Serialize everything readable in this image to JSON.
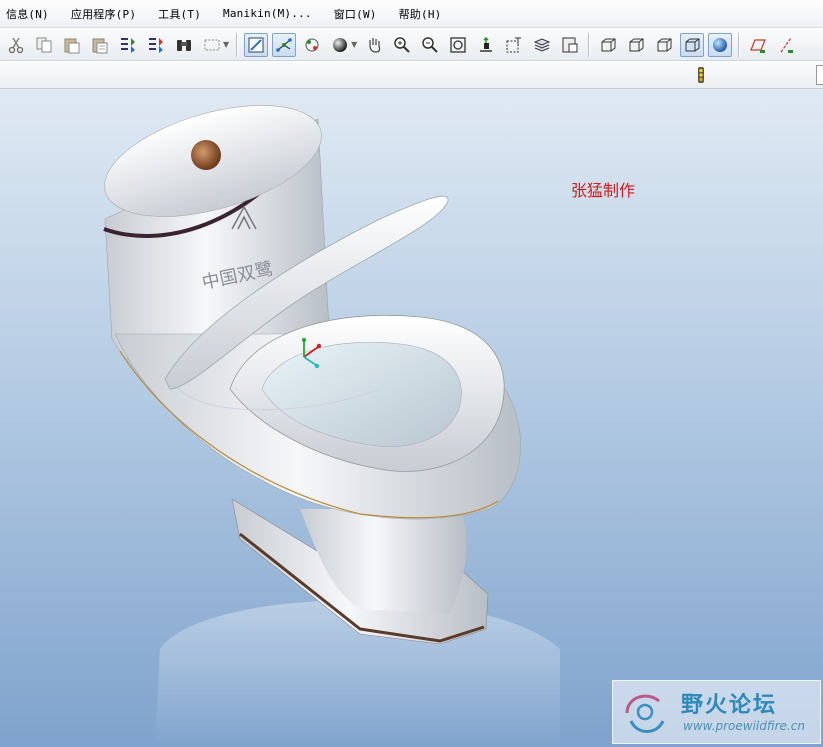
{
  "menu": {
    "items": [
      {
        "label": "信息(N)"
      },
      {
        "label": "应用程序(P)"
      },
      {
        "label": "工具(T)"
      },
      {
        "label": "Manikin(M)..."
      },
      {
        "label": "窗口(W)"
      },
      {
        "label": "帮助(H)"
      }
    ]
  },
  "toolbar": {
    "buttons": [
      {
        "icon": "cut-icon"
      },
      {
        "icon": "copy-icon"
      },
      {
        "icon": "paste-icon"
      },
      {
        "icon": "paste-special-icon"
      },
      {
        "icon": "regenerate-icon"
      },
      {
        "icon": "regenerate-manager-icon"
      },
      {
        "icon": "find-icon"
      },
      {
        "icon": "select-box-icon"
      },
      {
        "icon": "redraw-icon"
      },
      {
        "icon": "spin-center-icon"
      },
      {
        "icon": "orient-mode-icon"
      },
      {
        "icon": "appearance-gallery-icon"
      },
      {
        "icon": "pan-icon"
      },
      {
        "icon": "zoom-in-icon"
      },
      {
        "icon": "zoom-out-icon"
      },
      {
        "icon": "refit-icon"
      },
      {
        "icon": "reorient-icon"
      },
      {
        "icon": "saved-views-icon"
      },
      {
        "icon": "layers-icon"
      },
      {
        "icon": "view-manager-icon"
      },
      {
        "icon": "wireframe-icon"
      },
      {
        "icon": "hidden-line-icon"
      },
      {
        "icon": "no-hidden-icon"
      },
      {
        "icon": "shading-icon"
      },
      {
        "icon": "enhanced-realism-icon"
      },
      {
        "icon": "datum-plane-icon"
      },
      {
        "icon": "datum-axis-icon"
      }
    ]
  },
  "status": {
    "icon": "traffic-light-icon"
  },
  "viewport": {
    "credit_text": "张猛制作",
    "model_logo_text": "中国双鹭"
  },
  "watermark": {
    "title": "野火论坛",
    "url": "www.proewildfire.cn"
  },
  "colors": {
    "credit": "#d01c1c",
    "watermark": "#2e89b8",
    "viewport_top": "#dfe9f3",
    "viewport_bottom": "#7fa3cd"
  }
}
